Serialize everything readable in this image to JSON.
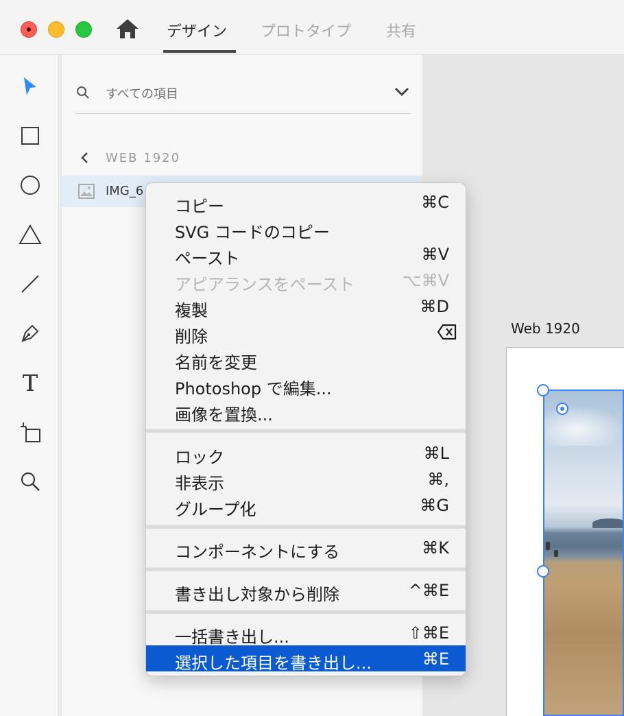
{
  "window": {
    "tabs": [
      {
        "label": "デザイン",
        "active": true
      },
      {
        "label": "プロトタイプ",
        "active": false
      },
      {
        "label": "共有",
        "active": false
      }
    ]
  },
  "toolbar": {
    "tools": [
      "select-icon",
      "rectangle-icon",
      "ellipse-icon",
      "triangle-icon",
      "line-icon",
      "pen-icon",
      "text-icon",
      "artboard-icon",
      "zoom-icon"
    ],
    "active_color": "#2b8cf5"
  },
  "layers": {
    "search_placeholder": "すべての項目",
    "artboard_label": "WEB 1920",
    "layer_name": "IMG_6"
  },
  "canvas": {
    "artboard_title": "Web 1920",
    "selection_color": "#3b82f6"
  },
  "context_menu": {
    "groups": [
      [
        {
          "label": "コピー",
          "shortcut": "⌘C"
        },
        {
          "label": "SVG コードのコピー",
          "shortcut": ""
        },
        {
          "label": "ペースト",
          "shortcut": "⌘V"
        },
        {
          "label": "アピアランスをペースト",
          "shortcut": "⌥⌘V",
          "disabled": true
        },
        {
          "label": "複製",
          "shortcut": "⌘D"
        },
        {
          "label": "削除",
          "shortcut": "delete-key-icon"
        },
        {
          "label": "名前を変更",
          "shortcut": ""
        },
        {
          "label": "Photoshop で編集...",
          "shortcut": ""
        },
        {
          "label": "画像を置換...",
          "shortcut": ""
        }
      ],
      [
        {
          "label": "ロック",
          "shortcut": "⌘L"
        },
        {
          "label": "非表示",
          "shortcut": "⌘,"
        },
        {
          "label": "グループ化",
          "shortcut": "⌘G"
        }
      ],
      [
        {
          "label": "コンポーネントにする",
          "shortcut": "⌘K"
        }
      ],
      [
        {
          "label": "書き出し対象から削除",
          "shortcut": "^⌘E"
        }
      ],
      [
        {
          "label": "一括書き出し...",
          "shortcut": "⇧⌘E"
        },
        {
          "label": "選択した項目を書き出し...",
          "shortcut": "⌘E",
          "selected": true
        }
      ]
    ],
    "selected_color": "#0a5bd1"
  }
}
